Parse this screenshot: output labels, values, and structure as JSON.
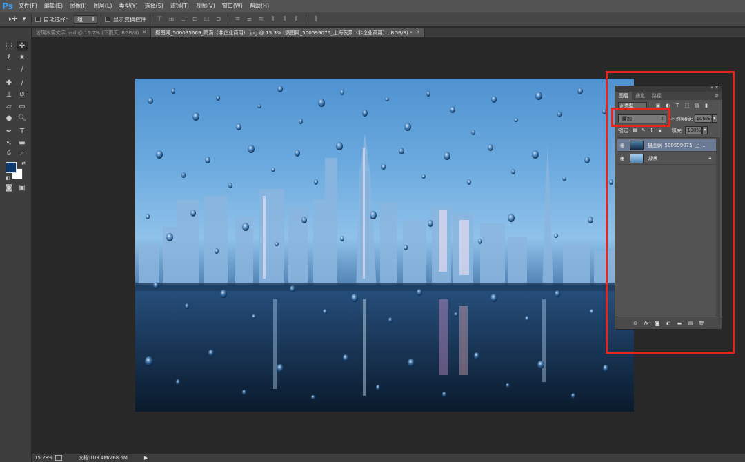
{
  "app": {
    "logo": "Ps"
  },
  "menubar": {
    "items": [
      "文件(F)",
      "编辑(E)",
      "图像(I)",
      "图层(L)",
      "类型(Y)",
      "选择(S)",
      "滤镜(T)",
      "视图(V)",
      "窗口(W)",
      "帮助(H)"
    ]
  },
  "options": {
    "tool_icon": "move-tool-icon",
    "auto_select_label": "自动选择：",
    "auto_select_value": "组",
    "transform_label": "显示变换控件"
  },
  "tabs": [
    {
      "label": "玻璃水雾文字.psd @ 16.7% (下雨天, RGB/8)",
      "active": false
    },
    {
      "label": "摄图网_500095669_雨滴（非企业商用）.jpg @ 15.3% (摄图网_500599075_上海夜景（非企业商用）, RGB/8) *",
      "active": true
    }
  ],
  "status": {
    "zoom": "15.28%",
    "doc_size": "文档:103.4M/268.6M"
  },
  "colors": {
    "foreground": "#0d3a6e",
    "background": "#ffffff",
    "highlight": "#e8241e"
  },
  "layers_panel": {
    "tabs": [
      "图层",
      "通道",
      "路径"
    ],
    "filter_kind": "ρ 类型",
    "blend_mode": "叠加",
    "opacity_label": "不透明度:",
    "opacity_value": "100%",
    "lock_label": "锁定:",
    "fill_label": "填充:",
    "fill_value": "100%",
    "layers": [
      {
        "name": "摄图网_500599075_上 ...",
        "selected": true,
        "locked": false
      },
      {
        "name": "背景",
        "selected": false,
        "locked": true
      }
    ]
  }
}
